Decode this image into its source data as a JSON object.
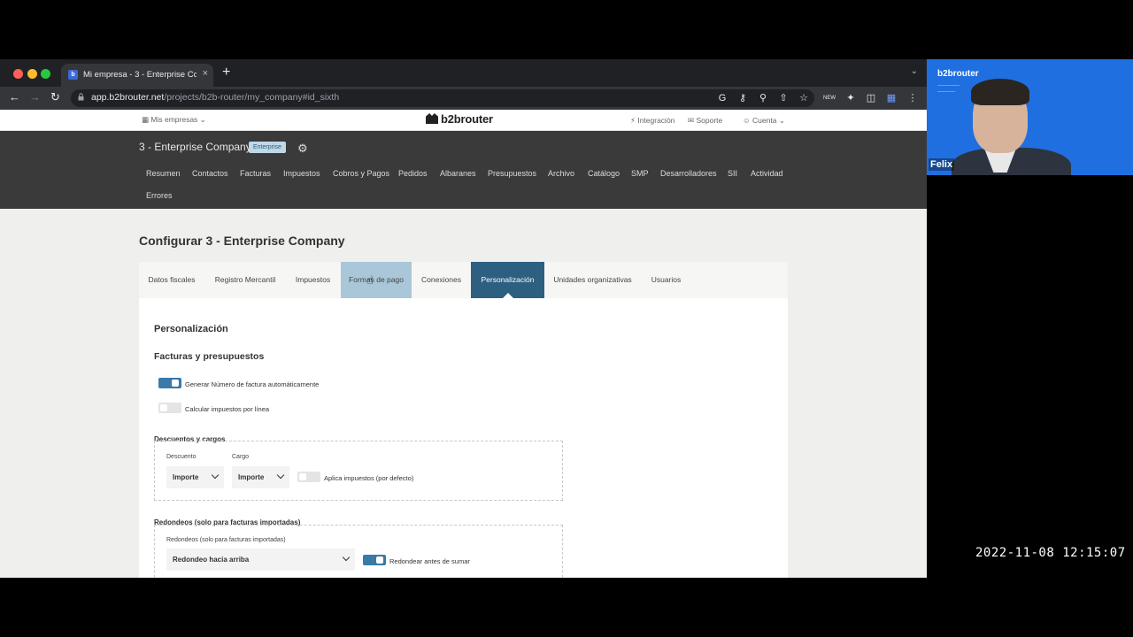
{
  "browser": {
    "tab_title": "Mi empresa - 3 - Enterprise Co",
    "new_tab": "+",
    "close_tab": "×",
    "url_host": "app.b2brouter.net",
    "url_path": "/projects/b2b-router/my_company#id_sixth"
  },
  "topbar": {
    "my_companies": "Mis empresas",
    "logo_text": "b2brouter",
    "integration": "Integración",
    "support": "Soporte",
    "account": "Cuenta"
  },
  "company": {
    "name": "3 - Enterprise Company",
    "plan_badge": "Enterprise"
  },
  "nav": {
    "items": [
      "Resumen",
      "Contactos",
      "Facturas",
      "Impuestos",
      "Cobros y Pagos",
      "Pedidos",
      "Albaranes",
      "Presupuestos",
      "Archivo",
      "Catálogo",
      "SMP",
      "Desarrolladores",
      "SII",
      "Actividad",
      "Errores"
    ]
  },
  "page": {
    "title": "Configurar 3 - Enterprise Company",
    "tabs": [
      "Datos fiscales",
      "Registro Mercantil",
      "Impuestos",
      "Formas de pago",
      "Conexiones",
      "Personalización",
      "Unidades organizativas",
      "Usuarios"
    ],
    "active_tab": "Personalización",
    "hover_tab": "Formas de pago"
  },
  "panel": {
    "heading": "Personalización",
    "section_invoices": "Facturas y presupuestos",
    "toggle_auto_number": {
      "label": "Generar Número de factura automáticamente",
      "on": true
    },
    "toggle_tax_per_line": {
      "label": "Calcular impuestos por línea",
      "on": false
    },
    "discounts": {
      "title": "Descuentos y cargos",
      "discount_label": "Descuento",
      "discount_value": "Importe",
      "charge_label": "Cargo",
      "charge_value": "Importe",
      "apply_taxes": {
        "label": "Aplica impuestos (por defecto)",
        "on": false
      }
    },
    "rounding": {
      "title": "Redondeos (solo para facturas importadas)",
      "field_label": "Redondeos (solo para facturas importadas)",
      "value": "Redondeo hacia arriba",
      "round_before_sum": {
        "label": "Redondear antes de sumar",
        "on": true
      }
    }
  },
  "video": {
    "brand": "b2brouter",
    "participant": "Felix"
  },
  "recording": {
    "timestamp": "2022-11-08 12:15:07"
  },
  "colors": {
    "active_tab": "#2c5f80",
    "hover_tab": "#a9c7d8",
    "toggle_on": "#3a7aa8",
    "company_bar": "#3a3a3a",
    "video_bg": "#1f6fe0"
  }
}
